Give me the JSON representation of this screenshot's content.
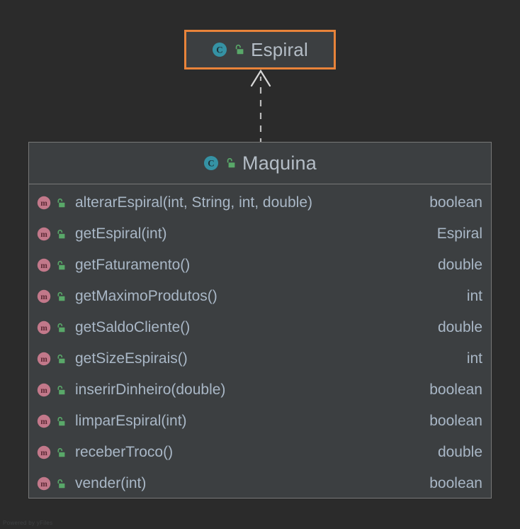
{
  "canvas": {
    "background_color": "#2b2b2b",
    "watermark": "Powered by yFiles"
  },
  "edge": {
    "name": "inheritance-edge",
    "style": "dashed",
    "arrowhead": "open-triangle",
    "color": "#bbbbbb",
    "from": "Maquina",
    "to": "Espiral"
  },
  "nodes": {
    "espiral": {
      "title": "Espiral",
      "stereotype_icon": "class-icon",
      "visibility_icon": "unlock-icon",
      "border_color": "#e8833a",
      "fill_color": "#3c3f41",
      "members": []
    },
    "maquina": {
      "title": "Maquina",
      "stereotype_icon": "class-icon",
      "visibility_icon": "unlock-icon",
      "border_color": "#787878",
      "fill_color": "#3c3f41",
      "members": [
        {
          "kind_icon": "method-icon",
          "visibility_icon": "unlock-icon",
          "signature": "alterarEspiral(int, String, int, double)",
          "type": "boolean"
        },
        {
          "kind_icon": "method-icon",
          "visibility_icon": "unlock-icon",
          "signature": "getEspiral(int)",
          "type": "Espiral"
        },
        {
          "kind_icon": "method-icon",
          "visibility_icon": "unlock-icon",
          "signature": "getFaturamento()",
          "type": "double"
        },
        {
          "kind_icon": "method-icon",
          "visibility_icon": "unlock-icon",
          "signature": "getMaximoProdutos()",
          "type": "int"
        },
        {
          "kind_icon": "method-icon",
          "visibility_icon": "unlock-icon",
          "signature": "getSaldoCliente()",
          "type": "double"
        },
        {
          "kind_icon": "method-icon",
          "visibility_icon": "unlock-icon",
          "signature": "getSizeEspirais()",
          "type": "int"
        },
        {
          "kind_icon": "method-icon",
          "visibility_icon": "unlock-icon",
          "signature": "inserirDinheiro(double)",
          "type": "boolean"
        },
        {
          "kind_icon": "method-icon",
          "visibility_icon": "unlock-icon",
          "signature": "limparEspiral(int)",
          "type": "boolean"
        },
        {
          "kind_icon": "method-icon",
          "visibility_icon": "unlock-icon",
          "signature": "receberTroco()",
          "type": "double"
        },
        {
          "kind_icon": "method-icon",
          "visibility_icon": "unlock-icon",
          "signature": "vender(int)",
          "type": "boolean"
        }
      ]
    }
  },
  "colors": {
    "class_icon": "#3592a4",
    "method_icon": "#c2788a",
    "lock_icon": "#59a869",
    "text": "#a9b7c6",
    "title_text": "#b4bdc6",
    "accent": "#e8833a"
  }
}
